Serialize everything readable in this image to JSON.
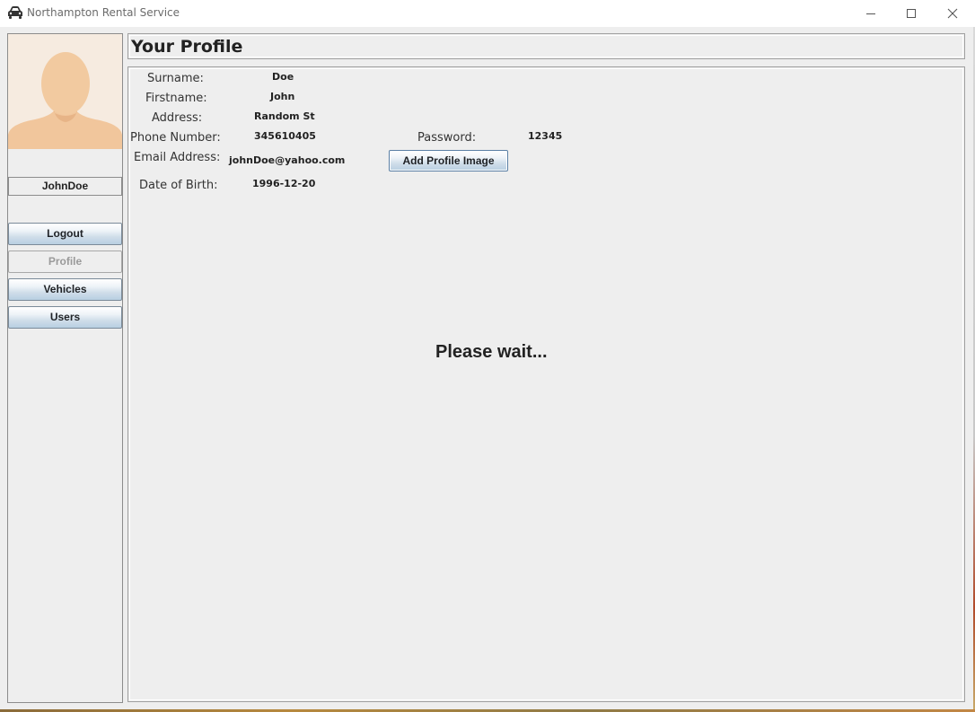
{
  "window": {
    "title": "Northampton Rental Service",
    "app_icon": "car-icon",
    "controls": [
      "minimize-icon",
      "maximize-icon",
      "close-icon"
    ]
  },
  "sidebar": {
    "avatar_icon": "default-avatar-silhouette",
    "username": "JohnDoe",
    "buttons": [
      {
        "label": "Logout",
        "enabled": true
      },
      {
        "label": "Profile",
        "enabled": false
      },
      {
        "label": "Vehicles",
        "enabled": true
      },
      {
        "label": "Users",
        "enabled": true
      }
    ]
  },
  "header": {
    "title": "Your Profile"
  },
  "profile": {
    "fields": [
      {
        "label": "Surname:",
        "value": "Doe"
      },
      {
        "label": "Firstname:",
        "value": "John"
      },
      {
        "label": "Address:",
        "value": "Random St"
      },
      {
        "label": "Phone Number:",
        "value": "345610405"
      },
      {
        "label": "Email Address:",
        "value": "johnDoe@yahoo.com"
      },
      {
        "label": "Date of Birth:",
        "value": "1996-12-20"
      }
    ],
    "password_label": "Password:",
    "password_value": "12345",
    "add_image_label": "Add Profile Image",
    "status_text": "Please wait..."
  },
  "colors": {
    "panel_bg": "#eeeeee",
    "button_gradient_top": "#ffffff",
    "button_gradient_bottom": "#b8cfe2",
    "avatar_skin": "#f2caa0",
    "avatar_bg": "#f6ebe0"
  }
}
